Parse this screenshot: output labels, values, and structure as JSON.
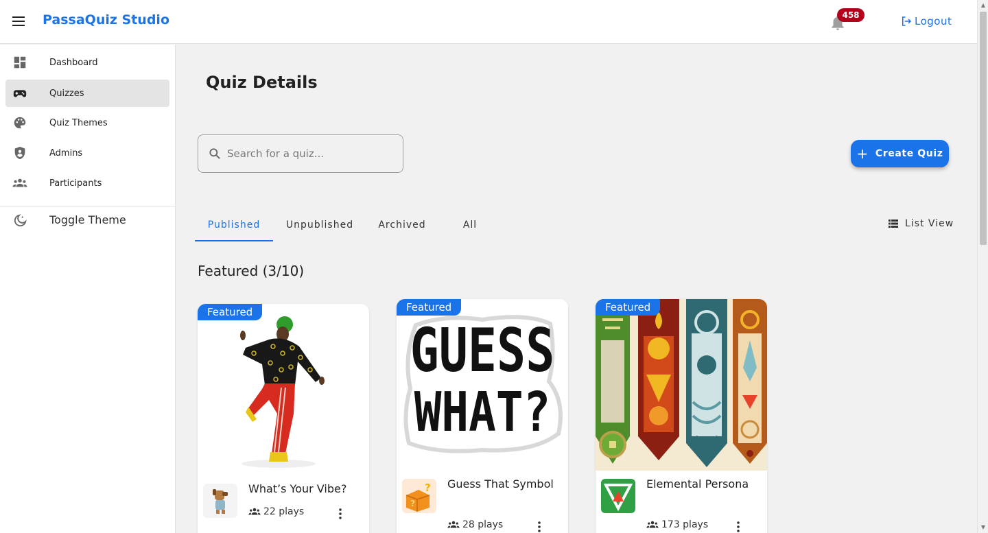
{
  "app": {
    "brand": "PassaQuiz Studio"
  },
  "header": {
    "notification_count": "458",
    "logout_label": "Logout"
  },
  "sidebar": {
    "items": [
      {
        "label": "Dashboard",
        "icon": "dashboard-icon"
      },
      {
        "label": "Quizzes",
        "icon": "gamepad-icon",
        "active": true
      },
      {
        "label": "Quiz Themes",
        "icon": "palette-icon"
      },
      {
        "label": "Admins",
        "icon": "shield-user-icon"
      },
      {
        "label": "Participants",
        "icon": "people-icon"
      }
    ],
    "toggle_theme": "Toggle Theme"
  },
  "main": {
    "title": "Quiz Details",
    "search_placeholder": "Search for a quiz...",
    "create_label": "Create Quiz",
    "tabs": [
      {
        "label": "Published",
        "active": true
      },
      {
        "label": "Unpublished"
      },
      {
        "label": "Archived"
      },
      {
        "label": "All"
      }
    ],
    "view_toggle": "List View",
    "section_title": "Featured (3/10)",
    "cards": [
      {
        "ribbon": "Featured",
        "title": "What’s Your Vibe?",
        "plays": "22 plays"
      },
      {
        "ribbon": "Featured",
        "title": "Guess That Symbol",
        "plays": "28 plays",
        "image_text_1": "GUESS",
        "image_text_2": "WHAT?"
      },
      {
        "ribbon": "Featured",
        "title": "Elemental Persona",
        "plays": "173 plays"
      }
    ]
  },
  "colors": {
    "accent": "#1a73e8",
    "badge": "#b3001b",
    "background": "#f1f1f1"
  }
}
